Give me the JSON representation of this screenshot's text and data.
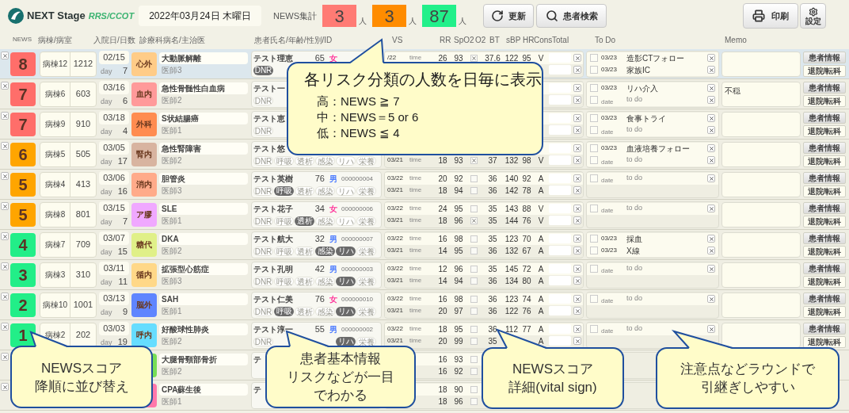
{
  "header": {
    "logo": {
      "name": "NEXT Stage",
      "suffix": "RRS/CCOT"
    },
    "date": "2022年03月24日 木曜日",
    "summary_label": "NEWS集計",
    "counts": [
      {
        "value": "3",
        "unit": "人",
        "color": "#ff7b74"
      },
      {
        "value": "3",
        "unit": "人",
        "color": "#ff8c00"
      },
      {
        "value": "87",
        "unit": "人",
        "color": "#22f08a"
      }
    ],
    "buttons": [
      {
        "kind": "refresh",
        "label": "更新"
      },
      {
        "kind": "search",
        "label": "患者検索"
      }
    ],
    "print": "印刷",
    "settings": "設定"
  },
  "columns": [
    "NEWS",
    "病棟/病室",
    "入院日/日数",
    "診療科",
    "病名/主治医",
    "患者氏名/年齢/性別/ID",
    "VS",
    "RR",
    "SpO2",
    "O2",
    "BT",
    "sBP",
    "HR",
    "Cons",
    "Total",
    "To Do",
    "Memo"
  ],
  "rows": [
    {
      "selected": true,
      "news": {
        "score": "8",
        "color": "#ff6e6a"
      },
      "ward": "病棟12",
      "room": "1212",
      "admitted": "02/15",
      "day_label": "day",
      "days": "7",
      "dept": {
        "name": "心外",
        "color": "#ffcc88"
      },
      "disease": "大動脈解離",
      "doctor": "医師3",
      "patient": {
        "name": "テスト理恵",
        "age": "65",
        "sex": {
          "text": "女",
          "color": "#ff3399"
        }
      },
      "tags": [
        {
          "label": "DNR",
          "on": true
        }
      ],
      "vitals": {
        "latest": {
          "date": "/22",
          "time": "time",
          "rr": "26",
          "spo2": "93",
          "o2": true,
          "bt": "37.6",
          "sbp": "122",
          "hr": "95",
          "cons": "V"
        }
      },
      "todos": [
        {
          "kind": "entry",
          "checked": false,
          "date": "03/23",
          "text": "造影CTフォロー"
        },
        {
          "kind": "entry",
          "checked": false,
          "date": "03/23",
          "text": "家族IC"
        }
      ],
      "actions": [
        "患者情報",
        "退院/転科"
      ]
    },
    {
      "selected": false,
      "news": {
        "score": "7",
        "color": "#ff6e6a"
      },
      "ward": "病棟6",
      "room": "603",
      "admitted": "03/16",
      "day_label": "day",
      "days": "6",
      "dept": {
        "name": "血内",
        "color": "#ff9a9a"
      },
      "disease": "急性骨髄性白血病",
      "doctor": "医師2",
      "patient": {
        "name": "テスト一"
      },
      "tags": [
        {
          "label": "DNR",
          "on": false
        }
      ],
      "todos": [
        {
          "kind": "entry",
          "checked": false,
          "date": "03/23",
          "text": "リハ介入"
        },
        {
          "kind": "blank",
          "checked": false,
          "date_placeholder": "date",
          "placeholder": "to do"
        }
      ],
      "memo": "不穏",
      "actions": [
        "患者情報",
        "退院/転科"
      ]
    },
    {
      "selected": false,
      "news": {
        "score": "7",
        "color": "#ff6e6a"
      },
      "ward": "病棟9",
      "room": "910",
      "admitted": "03/18",
      "day_label": "day",
      "days": "4",
      "dept": {
        "name": "外科",
        "color": "#ff8c50"
      },
      "disease": "S状結腸癌",
      "doctor": "医師1",
      "patient": {
        "name": "テスト恵"
      },
      "tags": [
        {
          "label": "DNR",
          "on": false
        }
      ],
      "todos": [
        {
          "kind": "entry",
          "checked": false,
          "date": "03/23",
          "text": "食事トライ"
        },
        {
          "kind": "blank",
          "checked": false,
          "date_placeholder": "date",
          "placeholder": "to do"
        }
      ],
      "actions": [
        "患者情報",
        "退院/転科"
      ]
    },
    {
      "selected": false,
      "news": {
        "score": "6",
        "color": "#ffa500"
      },
      "ward": "病棟5",
      "room": "505",
      "admitted": "03/05",
      "day_label": "day",
      "days": "17",
      "dept": {
        "name": "腎内",
        "color": "#d8b4a0"
      },
      "disease": "急性腎障害",
      "doctor": "医師2",
      "patient": {
        "name": "テスト悠"
      },
      "tags": [
        {
          "label": "DNR",
          "on": false
        },
        {
          "label": "呼吸",
          "on": false
        },
        {
          "label": "透析",
          "on": false
        },
        {
          "label": "感染",
          "on": false
        },
        {
          "label": "リハ",
          "on": false
        },
        {
          "label": "栄養",
          "on": false
        }
      ],
      "vitals": {
        "previous": {
          "date": "03/21",
          "time": "time",
          "rr": "18",
          "spo2": "93",
          "o2": true,
          "bt": "37",
          "sbp": "132",
          "hr": "98",
          "cons": "V"
        }
      },
      "todos": [
        {
          "kind": "entry",
          "checked": false,
          "date": "03/23",
          "text": "血液培養フォロー"
        },
        {
          "kind": "blank",
          "checked": false,
          "date_placeholder": "date",
          "placeholder": "to do"
        }
      ],
      "actions": [
        "患者情報",
        "退院/転科"
      ]
    },
    {
      "selected": false,
      "news": {
        "score": "5",
        "color": "#ffa500"
      },
      "ward": "病棟4",
      "room": "413",
      "admitted": "03/06",
      "day_label": "day",
      "days": "16",
      "dept": {
        "name": "消内",
        "color": "#ffab8a"
      },
      "disease": "胆管炎",
      "doctor": "医師3",
      "patient": {
        "name": "テスト英樹",
        "age": "76",
        "sex": {
          "text": "男",
          "color": "#4d7cff"
        },
        "id": "000000004"
      },
      "tags": [
        {
          "label": "DNR",
          "on": false
        },
        {
          "label": "呼吸",
          "on": true
        },
        {
          "label": "透析",
          "on": false
        },
        {
          "label": "感染",
          "on": false
        },
        {
          "label": "リハ",
          "on": false
        },
        {
          "label": "栄養",
          "on": false
        }
      ],
      "vitals": {
        "latest": {
          "date": "03/22",
          "time": "time",
          "rr": "20",
          "spo2": "92",
          "o2": false,
          "bt": "36",
          "sbp": "140",
          "hr": "92",
          "cons": "A"
        },
        "previous": {
          "date": "03/21",
          "time": "time",
          "rr": "18",
          "spo2": "94",
          "o2": false,
          "bt": "36",
          "sbp": "142",
          "hr": "78",
          "cons": "A"
        }
      },
      "todos": [
        {
          "kind": "blank",
          "checked": false,
          "date_placeholder": "date",
          "placeholder": "to do"
        }
      ],
      "actions": [
        "患者情報",
        "退院/転科"
      ]
    },
    {
      "selected": false,
      "news": {
        "score": "5",
        "color": "#ffa500"
      },
      "ward": "病棟8",
      "room": "801",
      "admitted": "03/15",
      "day_label": "day",
      "days": "7",
      "dept": {
        "name": "ア膠",
        "color": "#f0a8ff"
      },
      "disease": "SLE",
      "doctor": "医師1",
      "patient": {
        "name": "テスト花子",
        "age": "34",
        "sex": {
          "text": "女",
          "color": "#ff3399"
        },
        "id": "000000006"
      },
      "tags": [
        {
          "label": "DNR",
          "on": false
        },
        {
          "label": "呼吸",
          "on": false
        },
        {
          "label": "透析",
          "on": true
        },
        {
          "label": "感染",
          "on": false
        },
        {
          "label": "リハ",
          "on": false
        },
        {
          "label": "栄養",
          "on": false
        }
      ],
      "vitals": {
        "latest": {
          "date": "03/22",
          "time": "time",
          "rr": "24",
          "spo2": "95",
          "o2": false,
          "bt": "35",
          "sbp": "143",
          "hr": "88",
          "cons": "V"
        },
        "previous": {
          "date": "03/21",
          "time": "time",
          "rr": "18",
          "spo2": "96",
          "o2": true,
          "bt": "35",
          "sbp": "144",
          "hr": "76",
          "cons": "V"
        }
      },
      "todos": [
        {
          "kind": "blank",
          "checked": false,
          "date_placeholder": "date",
          "placeholder": "to do"
        }
      ],
      "actions": [
        "患者情報",
        "退院/転科"
      ]
    },
    {
      "selected": false,
      "news": {
        "score": "4",
        "color": "#22ee88"
      },
      "ward": "病棟7",
      "room": "709",
      "admitted": "03/07",
      "day_label": "day",
      "days": "15",
      "dept": {
        "name": "糖代",
        "color": "#e0f088"
      },
      "disease": "DKA",
      "doctor": "医師2",
      "patient": {
        "name": "テスト航大",
        "age": "32",
        "sex": {
          "text": "男",
          "color": "#4d7cff"
        },
        "id": "000000007"
      },
      "tags": [
        {
          "label": "DNR",
          "on": false
        },
        {
          "label": "呼吸",
          "on": false
        },
        {
          "label": "透析",
          "on": false
        },
        {
          "label": "感染",
          "on": true
        },
        {
          "label": "リハ",
          "on": true
        },
        {
          "label": "栄養",
          "on": false
        }
      ],
      "vitals": {
        "latest": {
          "date": "03/22",
          "time": "time",
          "rr": "16",
          "spo2": "98",
          "o2": false,
          "bt": "35",
          "sbp": "123",
          "hr": "70",
          "cons": "A"
        },
        "previous": {
          "date": "03/21",
          "time": "time",
          "rr": "14",
          "spo2": "95",
          "o2": false,
          "bt": "36",
          "sbp": "132",
          "hr": "67",
          "cons": "A"
        }
      },
      "todos": [
        {
          "kind": "entry",
          "checked": false,
          "date": "03/23",
          "text": "採血"
        },
        {
          "kind": "entry",
          "checked": false,
          "date": "03/23",
          "text": "X線"
        }
      ],
      "actions": [
        "患者情報",
        "退院/転科"
      ]
    },
    {
      "selected": false,
      "news": {
        "score": "3",
        "color": "#22ee88"
      },
      "ward": "病棟3",
      "room": "310",
      "admitted": "03/11",
      "day_label": "day",
      "days": "11",
      "dept": {
        "name": "循内",
        "color": "#ffd888"
      },
      "disease": "拡張型心筋症",
      "doctor": "医師3",
      "patient": {
        "name": "テスト孔明",
        "age": "42",
        "sex": {
          "text": "男",
          "color": "#4d7cff"
        },
        "id": "000000003"
      },
      "tags": [
        {
          "label": "DNR",
          "on": false
        },
        {
          "label": "呼吸",
          "on": false
        },
        {
          "label": "透析",
          "on": false
        },
        {
          "label": "感染",
          "on": false
        },
        {
          "label": "リハ",
          "on": true
        },
        {
          "label": "栄養",
          "on": false
        }
      ],
      "vitals": {
        "latest": {
          "date": "03/22",
          "time": "time",
          "rr": "12",
          "spo2": "96",
          "o2": false,
          "bt": "35",
          "sbp": "145",
          "hr": "72",
          "cons": "A"
        },
        "previous": {
          "date": "03/21",
          "time": "time",
          "rr": "14",
          "spo2": "94",
          "o2": false,
          "bt": "36",
          "sbp": "134",
          "hr": "80",
          "cons": "A"
        }
      },
      "todos": [
        {
          "kind": "blank",
          "checked": false,
          "date_placeholder": "date",
          "placeholder": "to do"
        }
      ],
      "actions": [
        "患者情報",
        "退院/転科"
      ]
    },
    {
      "selected": false,
      "news": {
        "score": "2",
        "color": "#22ee88"
      },
      "ward": "病棟10",
      "room": "1001",
      "admitted": "03/13",
      "day_label": "day",
      "days": "9",
      "dept": {
        "name": "脳外",
        "color": "#5f85ff"
      },
      "disease": "SAH",
      "doctor": "医師1",
      "patient": {
        "name": "テスト仁美",
        "age": "76",
        "sex": {
          "text": "女",
          "color": "#ff3399"
        },
        "id": "000000010"
      },
      "tags": [
        {
          "label": "DNR",
          "on": false
        },
        {
          "label": "呼吸",
          "on": true
        },
        {
          "label": "透析",
          "on": false
        },
        {
          "label": "感染",
          "on": false
        },
        {
          "label": "リハ",
          "on": true
        },
        {
          "label": "栄養",
          "on": false
        }
      ],
      "vitals": {
        "latest": {
          "date": "03/22",
          "time": "time",
          "rr": "16",
          "spo2": "98",
          "o2": false,
          "bt": "36",
          "sbp": "123",
          "hr": "74",
          "cons": "A"
        },
        "previous": {
          "date": "03/21",
          "time": "time",
          "rr": "20",
          "spo2": "97",
          "o2": false,
          "bt": "36",
          "sbp": "122",
          "hr": "76",
          "cons": "A"
        }
      },
      "todos": [
        {
          "kind": "blank",
          "checked": false,
          "date_placeholder": "date",
          "placeholder": "to do"
        }
      ],
      "actions": [
        "患者情報",
        "退院/転科"
      ]
    },
    {
      "selected": false,
      "news": {
        "score": "1",
        "color": "#22ee88"
      },
      "ward": "病棟2",
      "room": "202",
      "admitted": "03/03",
      "day_label": "day",
      "days": "19",
      "dept": {
        "name": "呼内",
        "color": "#66ddff"
      },
      "disease": "好酸球性肺炎",
      "doctor": "医師2",
      "patient": {
        "name": "テスト淳一",
        "age": "55",
        "sex": {
          "text": "男",
          "color": "#4d7cff"
        },
        "id": "000000002"
      },
      "tags": [
        {
          "label": "DNR",
          "on": false
        },
        {
          "label": "リハ",
          "on": true
        },
        {
          "label": "栄養",
          "on": false
        }
      ],
      "vitals": {
        "latest": {
          "date": "03/22",
          "time": "time",
          "rr": "18",
          "spo2": "95",
          "o2": false,
          "bt": "36",
          "sbp": "112",
          "hr": "77",
          "cons": "A"
        },
        "previous": {
          "date": "03/21",
          "time": "time",
          "rr": "20",
          "spo2": "99",
          "o2": false,
          "bt": "35",
          "cons": "A"
        }
      },
      "todos": [
        {
          "kind": "blank",
          "checked": false,
          "date_placeholder": "date",
          "placeholder": "to do"
        }
      ],
      "actions": [
        "患者情報",
        "退院/転科"
      ]
    },
    {
      "selected": false,
      "dept": {
        "color": "#77dd55"
      },
      "disease": "大腿骨頸部骨折",
      "doctor": "医師2",
      "patient": {
        "name": "テ"
      },
      "vitals": {
        "latest": {
          "rr": "16",
          "spo2": "93",
          "o2": false
        },
        "previous": {
          "rr": "16",
          "spo2": "92",
          "o2": false
        }
      }
    },
    {
      "selected": false,
      "dept": {
        "color": "#ff77aa"
      },
      "disease": "CPA蘇生後",
      "doctor": "医師1",
      "patient": {
        "name": "テ"
      },
      "vitals": {
        "latest": {
          "rr": "18",
          "spo2": "90",
          "o2": false
        },
        "previous": {
          "rr": "18",
          "spo2": "96",
          "o2": false
        }
      }
    }
  ],
  "callouts": [
    {
      "kind": "legend",
      "title": "各リスク分類の人数を日毎に表示",
      "items": [
        "高：NEWS ≧ 7",
        "中：NEWS＝5 or 6",
        "低：NEWS ≦ 4"
      ]
    },
    {
      "kind": "note",
      "lines": [
        "NEWSスコア",
        "降順に並び替え"
      ]
    },
    {
      "kind": "note",
      "lines": [
        "患者基本情報",
        "リスクなどが一目",
        "でわかる"
      ]
    },
    {
      "kind": "note",
      "lines": [
        "NEWSスコア",
        "詳細(vital sign)"
      ]
    },
    {
      "kind": "note",
      "lines": [
        "注意点などラウンドで",
        "引継ぎしやすい"
      ]
    }
  ]
}
